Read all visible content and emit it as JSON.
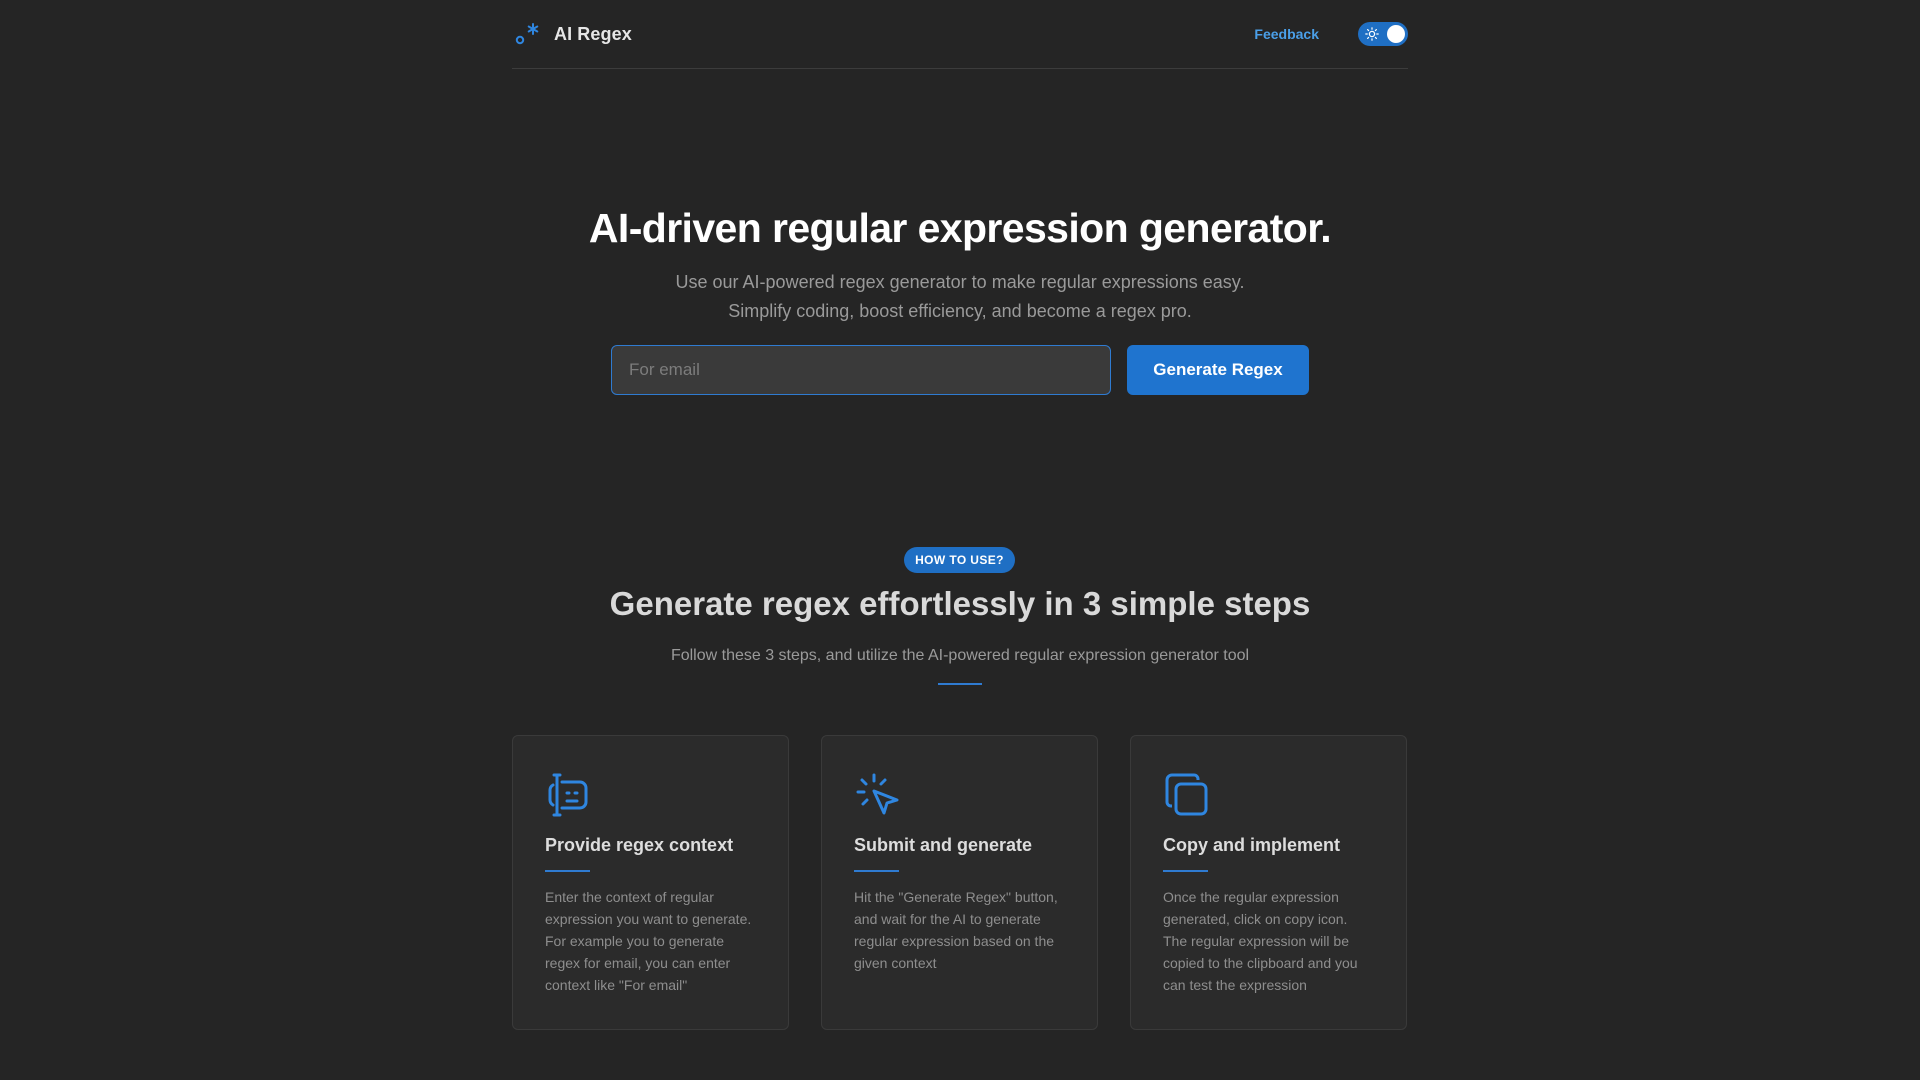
{
  "header": {
    "brand_name": "AI Regex",
    "feedback_label": "Feedback"
  },
  "hero": {
    "title": "AI-driven regular expression generator.",
    "subtitle_line1": "Use our AI-powered regex generator to make regular expressions easy.",
    "subtitle_line2": "Simplify coding, boost efficiency, and become a regex pro.",
    "input_placeholder": "For email",
    "input_value": "",
    "generate_label": "Generate Regex"
  },
  "how_to": {
    "badge": "HOW TO USE?",
    "title": "Generate regex effortlessly in 3 simple steps",
    "subtitle": "Follow these 3 steps, and utilize the AI-powered regular expression generator tool"
  },
  "steps": [
    {
      "icon": "text-cursor-icon",
      "title": "Provide regex context",
      "text": "Enter the context of regular expression you want to generate. For example you to generate regex for email, you can enter context like \"For email\""
    },
    {
      "icon": "click-pointer-icon",
      "title": "Submit and generate",
      "text": "Hit the \"Generate Regex\" button, and wait for the AI to generate regular expression based on the given context"
    },
    {
      "icon": "copy-icon",
      "title": "Copy and implement",
      "text": "Once the regular expression generated, click on copy icon. The regular expression will be copied to the clipboard and you can test the expression"
    }
  ],
  "colors": {
    "background": "#252525",
    "accent": "#1f74cf",
    "link": "#4a9fe8",
    "card": "#2b2b2b"
  },
  "theme": {
    "toggle_on": true
  }
}
